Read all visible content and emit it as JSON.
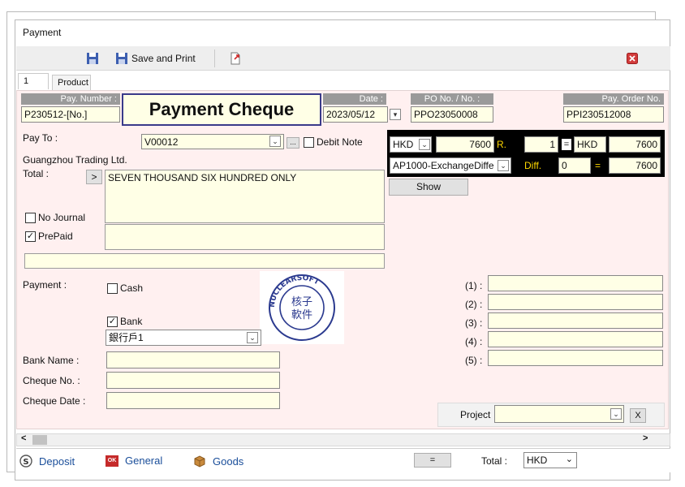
{
  "window": {
    "title": "Payment"
  },
  "toolbar": {
    "save_and_print_label": "Save and Print"
  },
  "tabs": [
    {
      "label": "1"
    },
    {
      "label": "Product"
    }
  ],
  "header": {
    "pay_number_label": "Pay. Number :",
    "pay_number_value": "P230512-[No.]",
    "doc_title": "Payment Cheque",
    "date_label": "Date :",
    "date_value": "2023/05/12",
    "po_label": "PO No. / No. :",
    "po_value": "PPO23050008",
    "pay_order_label": "Pay. Order No.",
    "pay_order_value": "PPI230512008"
  },
  "pay_to": {
    "label": "Pay To :",
    "code": "V00012",
    "ellipsis": "...",
    "debit_note_label": "Debit Note",
    "company": "Guangzhou Trading Ltd.",
    "total_label": "Total :",
    "total_button": ">",
    "amount_words": "SEVEN THOUSAND SIX HUNDRED ONLY",
    "no_journal_label": "No Journal",
    "prepaid_label": "PrePaid",
    "prepaid_checked": "✓"
  },
  "exchange": {
    "currency": "HKD",
    "amount": "7600",
    "rate_label": "R.",
    "rate": "1",
    "eq": "=",
    "currency2": "HKD",
    "amount2": "7600",
    "account": "AP1000-ExchangeDiffe",
    "diff_label": "Diff.",
    "diff": "0",
    "eq2": "=",
    "result": "7600",
    "show_label": "Show"
  },
  "payment": {
    "label": "Payment :",
    "cash_label": "Cash",
    "bank_label": "Bank",
    "bank_checked": "✓",
    "bank_account": "銀行戶1",
    "bank_name_label": "Bank Name :",
    "cheque_no_label": "Cheque No. :",
    "cheque_date_label": "Cheque Date :"
  },
  "stamp": {
    "ring_text": "NUCLEARSOFT",
    "center_line1": "核子",
    "center_line2": "軟件",
    "color": "#2b3a8f"
  },
  "notes": [
    {
      "label": "(1) :"
    },
    {
      "label": "(2) :"
    },
    {
      "label": "(3) :"
    },
    {
      "label": "(4) :"
    },
    {
      "label": "(5) :"
    }
  ],
  "project": {
    "label": "Project",
    "clear_label": "X"
  },
  "scrollbar": {
    "left_arrow": "<",
    "right_arrow": ">"
  },
  "status": {
    "deposit_label": "Deposit",
    "general_label": "General",
    "general_icon_text": "OK",
    "goods_label": "Goods",
    "eq_button": "=",
    "total_label": "Total :",
    "currency": "HKD"
  },
  "colors": {
    "field_bg": "#ffffe6",
    "panel_bg": "#fff0f0",
    "header_label_bg": "#9a9a9a",
    "link": "#1a4e9a"
  }
}
